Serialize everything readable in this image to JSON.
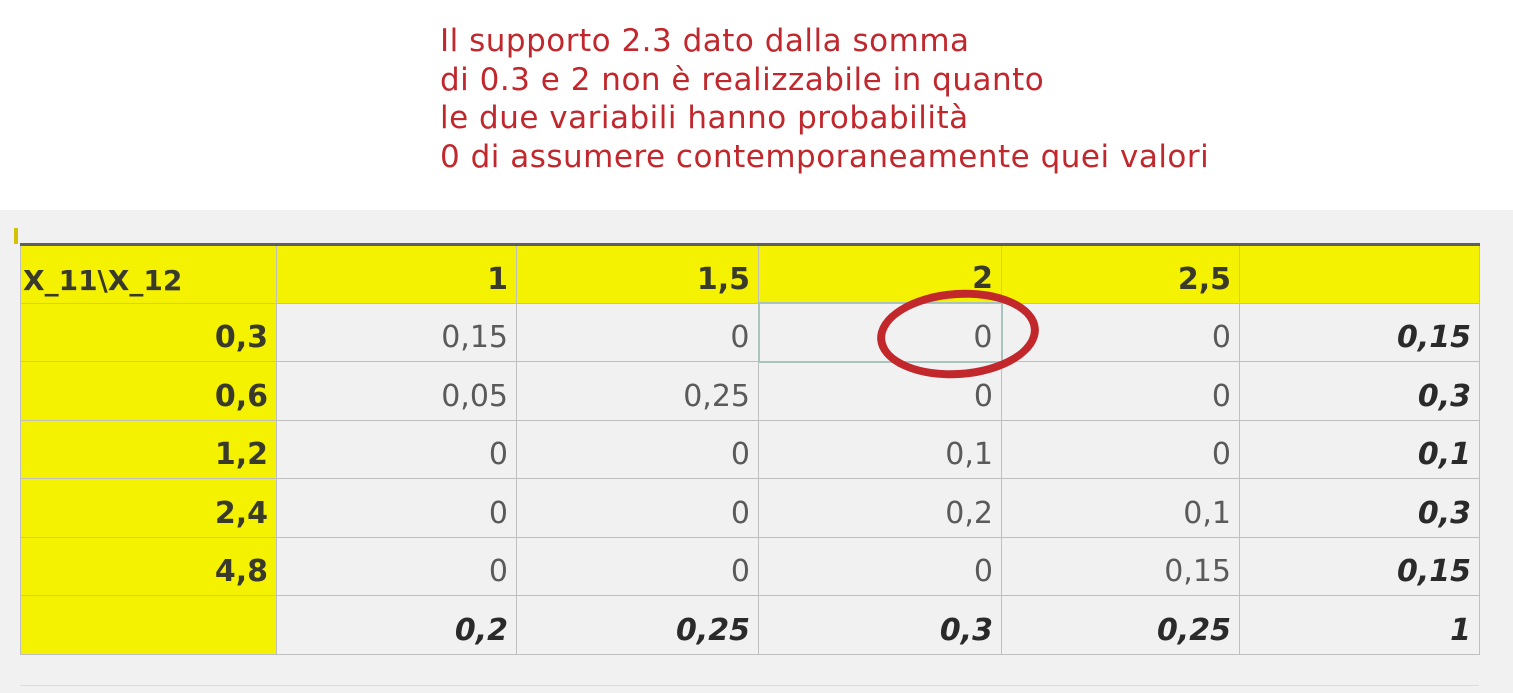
{
  "annotation": {
    "lines": [
      "Il supporto 2.3 dato dalla somma",
      "di 0.3 e 2 non è realizzabile in quanto",
      "le due variabili hanno probabilità",
      "0 di assumere contemporaneamente quei valori"
    ],
    "color": "#c0282d"
  },
  "table": {
    "header": {
      "corner": "X_11\\X_12",
      "columns": [
        "1",
        "1,5",
        "2",
        "2,5",
        ""
      ]
    },
    "rows": [
      {
        "label": "0,3",
        "cells": [
          "0,15",
          "0",
          "0",
          "0"
        ],
        "total": "0,15"
      },
      {
        "label": "0,6",
        "cells": [
          "0,05",
          "0,25",
          "0",
          "0"
        ],
        "total": "0,3"
      },
      {
        "label": "1,2",
        "cells": [
          "0",
          "0",
          "0,1",
          "0"
        ],
        "total": "0,1"
      },
      {
        "label": "2,4",
        "cells": [
          "0",
          "0",
          "0,2",
          "0,1"
        ],
        "total": "0,3"
      },
      {
        "label": "4,8",
        "cells": [
          "0",
          "0",
          "0",
          "0,15"
        ],
        "total": "0,15"
      }
    ],
    "totals": {
      "label": "",
      "cells": [
        "0,2",
        "0,25",
        "0,3",
        "0,25"
      ],
      "total": "1"
    },
    "highlight_color": "#f4f200",
    "circle_color": "#c2282b"
  }
}
